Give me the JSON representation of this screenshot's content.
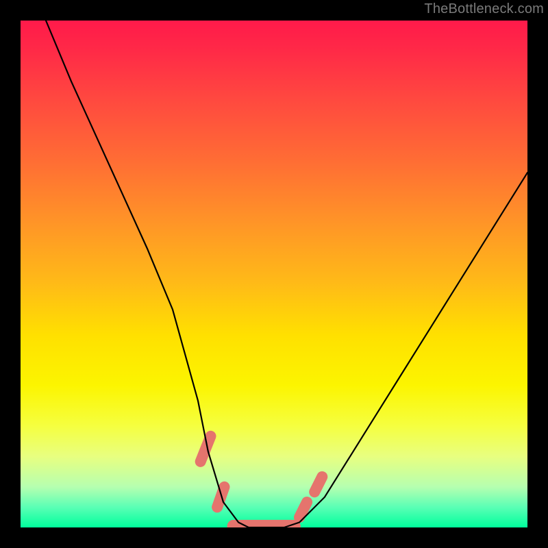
{
  "watermark": "TheBottleneck.com",
  "chart_data": {
    "type": "line",
    "title": "",
    "xlabel": "",
    "ylabel": "",
    "xlim": [
      0,
      100
    ],
    "ylim": [
      0,
      100
    ],
    "series": [
      {
        "name": "curve",
        "color": "#000000",
        "x": [
          5,
          10,
          15,
          20,
          25,
          30,
          35,
          37,
          40,
          43,
          45,
          48,
          50,
          52,
          55,
          60,
          65,
          70,
          75,
          80,
          85,
          90,
          95,
          100
        ],
        "y": [
          100,
          88,
          77,
          66,
          55,
          43,
          25,
          15,
          5,
          1,
          0,
          0,
          0,
          0,
          1,
          6,
          14,
          22,
          30,
          38,
          46,
          54,
          62,
          70
        ]
      }
    ],
    "markers": [
      {
        "shape": "capsule",
        "x0": 35.5,
        "x1": 37.5,
        "y0": 13,
        "y1": 18,
        "color": "#e5746d"
      },
      {
        "shape": "capsule",
        "x0": 38.8,
        "x1": 40.2,
        "y0": 4,
        "y1": 8,
        "color": "#e5746d"
      },
      {
        "shape": "capsule",
        "x0": 42,
        "x1": 54,
        "y0": -1,
        "y1": 1.5,
        "color": "#e5746d"
      },
      {
        "shape": "capsule",
        "x0": 55,
        "x1": 56.5,
        "y0": 2,
        "y1": 5,
        "color": "#e5746d"
      },
      {
        "shape": "capsule",
        "x0": 58,
        "x1": 59.5,
        "y0": 7,
        "y1": 10,
        "color": "#e5746d"
      }
    ]
  }
}
